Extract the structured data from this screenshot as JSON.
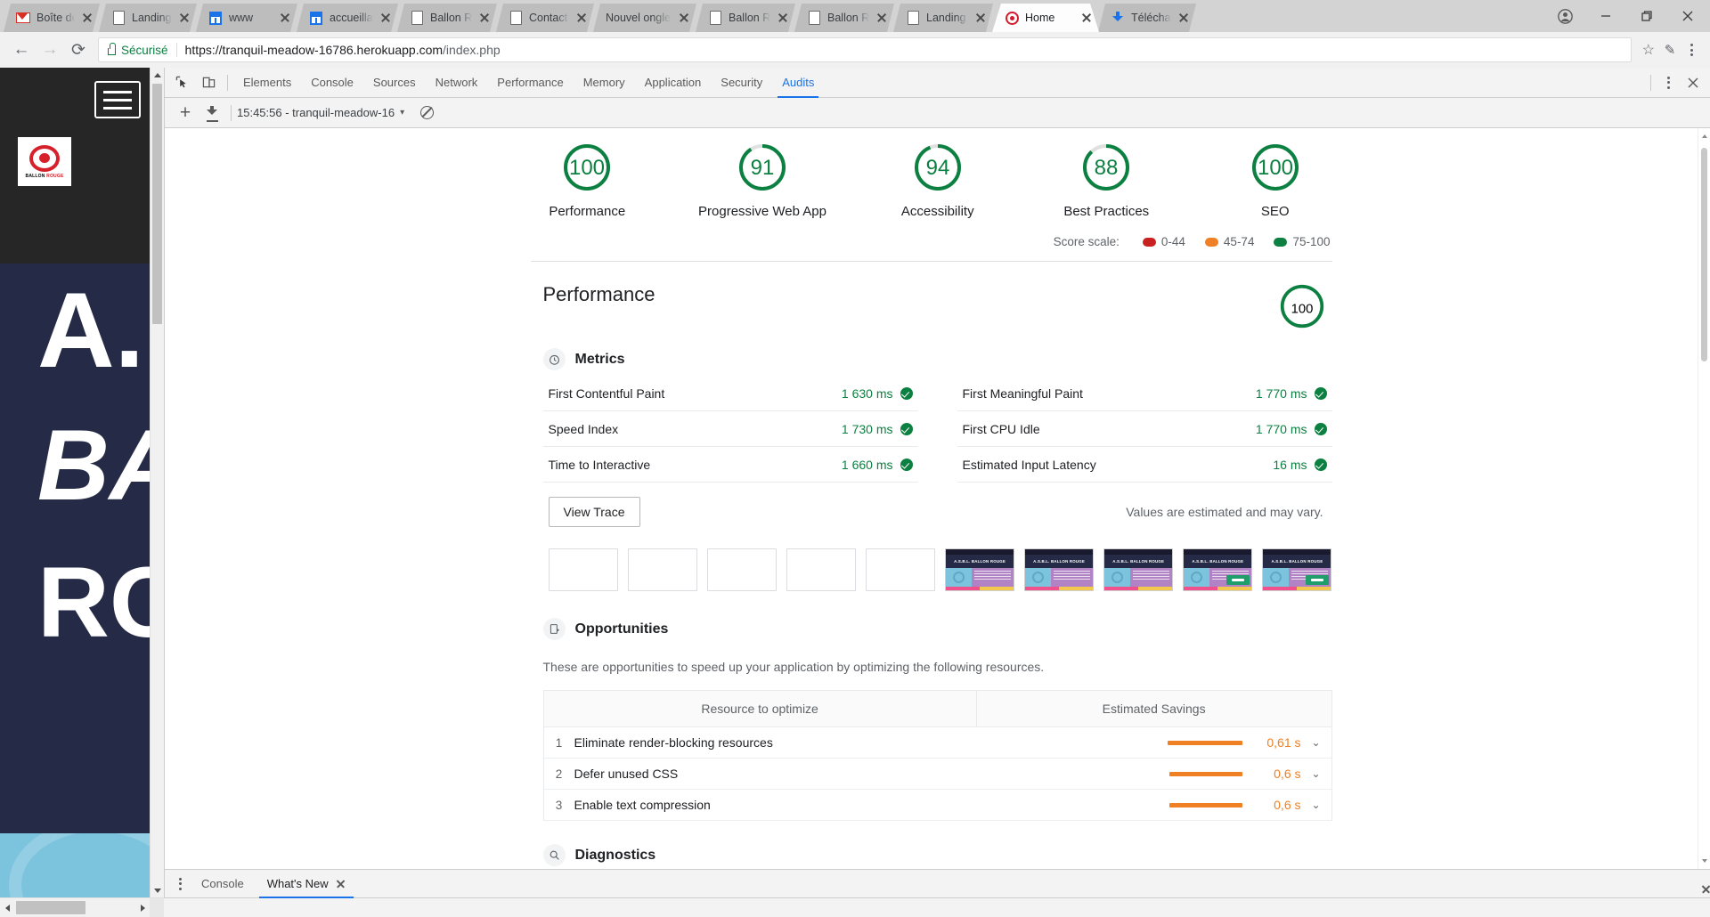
{
  "browser": {
    "tabs": [
      {
        "title": "Boîte de ré",
        "icon": "gmail-icon",
        "active": false
      },
      {
        "title": "Landing -",
        "icon": "document-icon",
        "active": false
      },
      {
        "title": "www",
        "icon": "blue-page-icon",
        "active": false
      },
      {
        "title": "accueillan",
        "icon": "blue-page-icon",
        "active": false
      },
      {
        "title": "Ballon Ro",
        "icon": "document-icon",
        "active": false
      },
      {
        "title": "Contact F",
        "icon": "document-icon",
        "active": false
      },
      {
        "title": "Nouvel ongle",
        "icon": "none",
        "active": false
      },
      {
        "title": "Ballon Ro",
        "icon": "document-icon",
        "active": false
      },
      {
        "title": "Ballon Ro",
        "icon": "document-icon",
        "active": false
      },
      {
        "title": "Landing -",
        "icon": "document-icon",
        "active": false
      },
      {
        "title": "Home",
        "icon": "ballon-rouge-icon",
        "active": true
      },
      {
        "title": "Télécharg",
        "icon": "download-icon",
        "active": false
      }
    ],
    "window_controls": {
      "profile": "account-icon",
      "minimize": "minimize-icon",
      "maximize": "maximize-icon",
      "close": "close-icon"
    },
    "omnibox": {
      "back": "back-arrow-icon",
      "forward": "forward-arrow-icon",
      "reload": "reload-icon",
      "secure_label": "Sécurisé",
      "url_host": "https://tranquil-meadow-16786.herokuapp.com",
      "url_path": "/index.php",
      "bookmark": "star-icon",
      "extension": "pen-icon",
      "menu": "chrome-menu-icon"
    }
  },
  "website": {
    "logo_brand": "BALLON",
    "logo_brand_accent": "ROUGE",
    "hero_lines": [
      "A.",
      "BA",
      "RO"
    ]
  },
  "devtools": {
    "panels": [
      "Elements",
      "Console",
      "Sources",
      "Network",
      "Performance",
      "Memory",
      "Application",
      "Security",
      "Audits"
    ],
    "active_panel": "Audits",
    "inspect_icon": "inspect-element-icon",
    "device_icon": "device-toolbar-icon",
    "more_icon": "more-options-icon",
    "close_icon": "close-devtools-icon",
    "audit_toolbar": {
      "add_label": "+",
      "export_icon": "export-icon",
      "selected_report": "15:45:56 - tranquil-meadow-16",
      "caret": "▾",
      "clear_icon": "clear-all-icon"
    },
    "drawer": {
      "tabs": [
        {
          "label": "Console",
          "active": false,
          "closable": false
        },
        {
          "label": "What's New",
          "active": true,
          "closable": true
        }
      ],
      "close_icon": "close-drawer-icon",
      "menu_icon": "drawer-menu-icon"
    }
  },
  "report": {
    "gauges": [
      {
        "label": "Performance",
        "score": 100,
        "color": "#0c8040"
      },
      {
        "label": "Progressive Web App",
        "score": 91,
        "color": "#0c8040"
      },
      {
        "label": "Accessibility",
        "score": 94,
        "color": "#0c8040"
      },
      {
        "label": "Best Practices",
        "score": 88,
        "color": "#0c8040"
      },
      {
        "label": "SEO",
        "score": 100,
        "color": "#0c8040"
      }
    ],
    "score_scale": {
      "label": "Score scale:",
      "ranges": [
        {
          "text": "0-44",
          "color": "#c7221f"
        },
        {
          "text": "45-74",
          "color": "#ef8023"
        },
        {
          "text": "75-100",
          "color": "#0c8040"
        }
      ]
    },
    "category": {
      "title": "Performance",
      "score": 100
    },
    "metrics_section": {
      "icon": "timer-icon",
      "title": "Metrics",
      "left": [
        {
          "name": "First Contentful Paint",
          "value": "1 630 ms",
          "status": "pass"
        },
        {
          "name": "Speed Index",
          "value": "1 730 ms",
          "status": "pass"
        },
        {
          "name": "Time to Interactive",
          "value": "1 660 ms",
          "status": "pass"
        }
      ],
      "right": [
        {
          "name": "First Meaningful Paint",
          "value": "1 770 ms",
          "status": "pass"
        },
        {
          "name": "First CPU Idle",
          "value": "1 770 ms",
          "status": "pass"
        },
        {
          "name": "Estimated Input Latency",
          "value": "16 ms",
          "status": "pass"
        }
      ],
      "view_trace_label": "View Trace",
      "note": "Values are estimated and may vary.",
      "filmstrip": [
        {
          "loaded": false
        },
        {
          "loaded": false
        },
        {
          "loaded": false
        },
        {
          "loaded": false
        },
        {
          "loaded": false
        },
        {
          "loaded": true,
          "title": "A.S.B.L. BALLON ROUGE",
          "cta": false
        },
        {
          "loaded": true,
          "title": "A.S.B.L. BALLON ROUGE",
          "cta": false
        },
        {
          "loaded": true,
          "title": "A.S.B.L. BALLON ROUGE",
          "cta": false
        },
        {
          "loaded": true,
          "title": "A.S.B.L. BALLON ROUGE",
          "cta": true
        },
        {
          "loaded": true,
          "title": "A.S.B.L. BALLON ROUGE",
          "cta": true
        }
      ]
    },
    "opportunities_section": {
      "icon": "opportunities-icon",
      "title": "Opportunities",
      "description": "These are opportunities to speed up your application by optimizing the following resources.",
      "columns": [
        "Resource to optimize",
        "Estimated Savings"
      ],
      "rows": [
        {
          "num": "1",
          "name": "Eliminate render-blocking resources",
          "savings": "0,61 s",
          "bar_pct": 100
        },
        {
          "num": "2",
          "name": "Defer unused CSS",
          "savings": "0,6 s",
          "bar_pct": 98
        },
        {
          "num": "3",
          "name": "Enable text compression",
          "savings": "0,6 s",
          "bar_pct": 98
        }
      ]
    },
    "diagnostics_section": {
      "icon": "search-icon",
      "title": "Diagnostics"
    }
  }
}
